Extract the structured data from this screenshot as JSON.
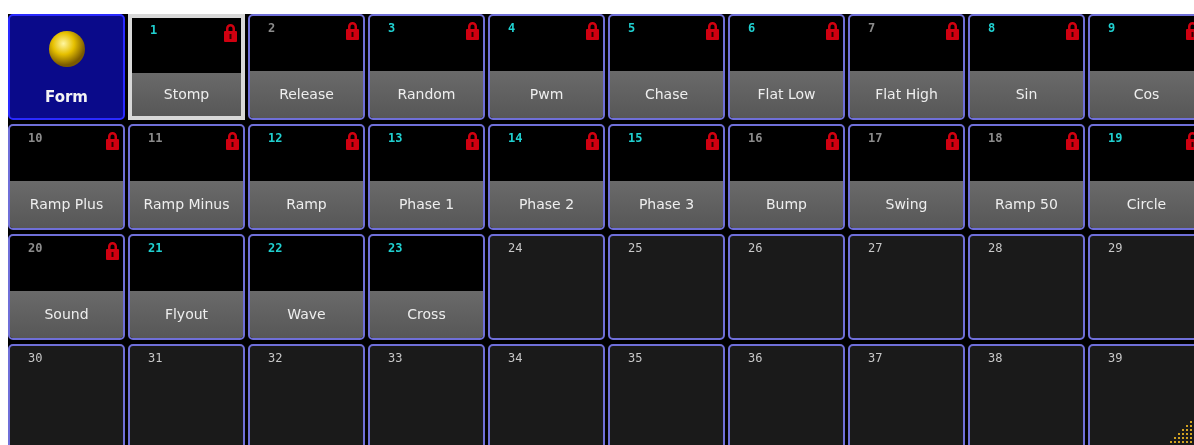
{
  "tiles": [
    {
      "kind": "form",
      "label": "Form",
      "selected": false
    },
    {
      "kind": "preset",
      "number": "1",
      "label": "Stomp",
      "active": true,
      "locked": true,
      "selected": true
    },
    {
      "kind": "preset",
      "number": "2",
      "label": "Release",
      "active": false,
      "locked": true,
      "selected": false
    },
    {
      "kind": "preset",
      "number": "3",
      "label": "Random",
      "active": true,
      "locked": true,
      "selected": false
    },
    {
      "kind": "preset",
      "number": "4",
      "label": "Pwm",
      "active": true,
      "locked": true,
      "selected": false
    },
    {
      "kind": "preset",
      "number": "5",
      "label": "Chase",
      "active": true,
      "locked": true,
      "selected": false
    },
    {
      "kind": "preset",
      "number": "6",
      "label": "Flat Low",
      "active": true,
      "locked": true,
      "selected": false
    },
    {
      "kind": "preset",
      "number": "7",
      "label": "Flat High",
      "active": false,
      "locked": true,
      "selected": false
    },
    {
      "kind": "preset",
      "number": "8",
      "label": "Sin",
      "active": true,
      "locked": true,
      "selected": false
    },
    {
      "kind": "preset",
      "number": "9",
      "label": "Cos",
      "active": true,
      "locked": true,
      "selected": false
    },
    {
      "kind": "preset",
      "number": "10",
      "label": "Ramp Plus",
      "active": false,
      "locked": true,
      "selected": false
    },
    {
      "kind": "preset",
      "number": "11",
      "label": "Ramp Minus",
      "active": false,
      "locked": true,
      "selected": false
    },
    {
      "kind": "preset",
      "number": "12",
      "label": "Ramp",
      "active": true,
      "locked": true,
      "selected": false
    },
    {
      "kind": "preset",
      "number": "13",
      "label": "Phase 1",
      "active": true,
      "locked": true,
      "selected": false
    },
    {
      "kind": "preset",
      "number": "14",
      "label": "Phase 2",
      "active": true,
      "locked": true,
      "selected": false
    },
    {
      "kind": "preset",
      "number": "15",
      "label": "Phase 3",
      "active": true,
      "locked": true,
      "selected": false
    },
    {
      "kind": "preset",
      "number": "16",
      "label": "Bump",
      "active": false,
      "locked": true,
      "selected": false
    },
    {
      "kind": "preset",
      "number": "17",
      "label": "Swing",
      "active": false,
      "locked": true,
      "selected": false
    },
    {
      "kind": "preset",
      "number": "18",
      "label": "Ramp 50",
      "active": false,
      "locked": true,
      "selected": false
    },
    {
      "kind": "preset",
      "number": "19",
      "label": "Circle",
      "active": true,
      "locked": true,
      "selected": false
    },
    {
      "kind": "preset",
      "number": "20",
      "label": "Sound",
      "active": false,
      "locked": true,
      "selected": false
    },
    {
      "kind": "preset",
      "number": "21",
      "label": "Flyout",
      "active": true,
      "locked": false,
      "selected": false
    },
    {
      "kind": "preset",
      "number": "22",
      "label": "Wave",
      "active": true,
      "locked": false,
      "selected": false
    },
    {
      "kind": "preset",
      "number": "23",
      "label": "Cross",
      "active": true,
      "locked": false,
      "selected": false
    },
    {
      "kind": "empty",
      "number": "24",
      "selected": false
    },
    {
      "kind": "empty",
      "number": "25",
      "selected": false
    },
    {
      "kind": "empty",
      "number": "26",
      "selected": false
    },
    {
      "kind": "empty",
      "number": "27",
      "selected": false
    },
    {
      "kind": "empty",
      "number": "28",
      "selected": false
    },
    {
      "kind": "empty",
      "number": "29",
      "selected": false
    },
    {
      "kind": "empty",
      "number": "30",
      "selected": false
    },
    {
      "kind": "empty",
      "number": "31",
      "selected": false
    },
    {
      "kind": "empty",
      "number": "32",
      "selected": false
    },
    {
      "kind": "empty",
      "number": "33",
      "selected": false
    },
    {
      "kind": "empty",
      "number": "34",
      "selected": false
    },
    {
      "kind": "empty",
      "number": "35",
      "selected": false
    },
    {
      "kind": "empty",
      "number": "36",
      "selected": false
    },
    {
      "kind": "empty",
      "number": "37",
      "selected": false
    },
    {
      "kind": "empty",
      "number": "38",
      "selected": false
    },
    {
      "kind": "empty",
      "number": "39",
      "selected": false
    }
  ]
}
